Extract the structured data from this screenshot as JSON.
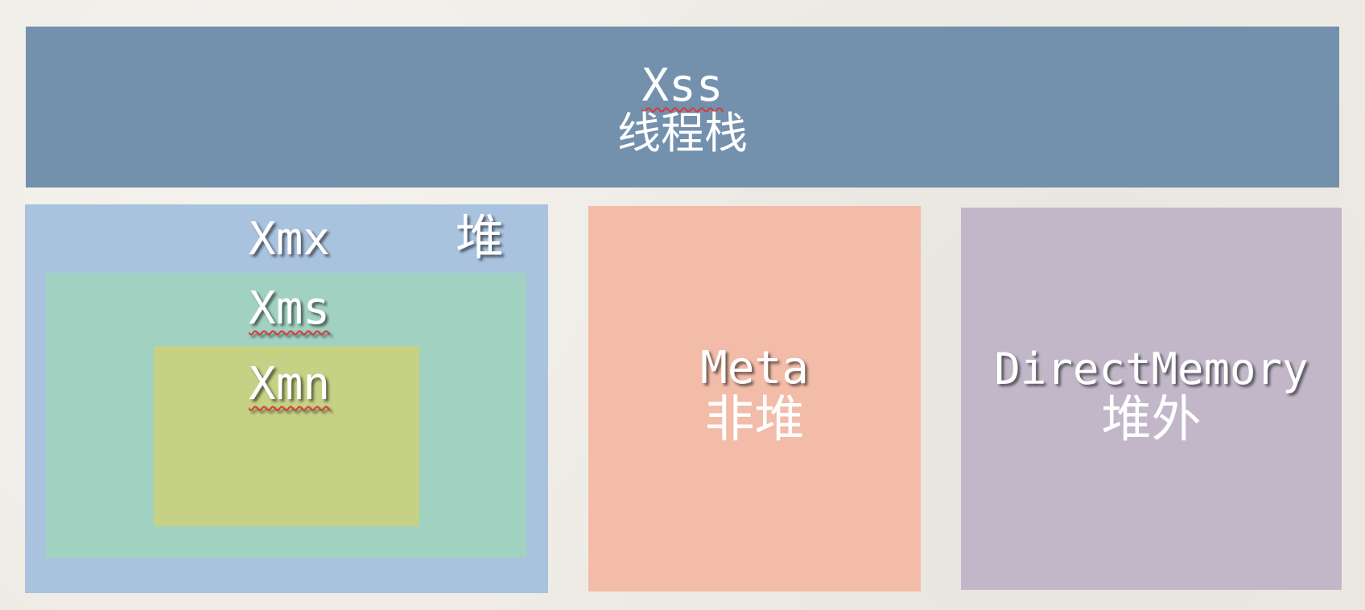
{
  "stack": {
    "flag": "Xss",
    "name": "线程栈",
    "color": "#7390ad"
  },
  "heap": {
    "flag": "Xmx",
    "name": "堆",
    "color": "#a9c3df",
    "inner": {
      "flag": "Xms",
      "color": "#a1d2c1",
      "inner": {
        "flag": "Xmn",
        "color": "#c5d185"
      }
    }
  },
  "meta": {
    "flag": "Meta",
    "name": "非堆",
    "color": "#f2bca8"
  },
  "direct": {
    "flag": "DirectMemory",
    "name": "堆外",
    "color": "#c1b7c9"
  }
}
